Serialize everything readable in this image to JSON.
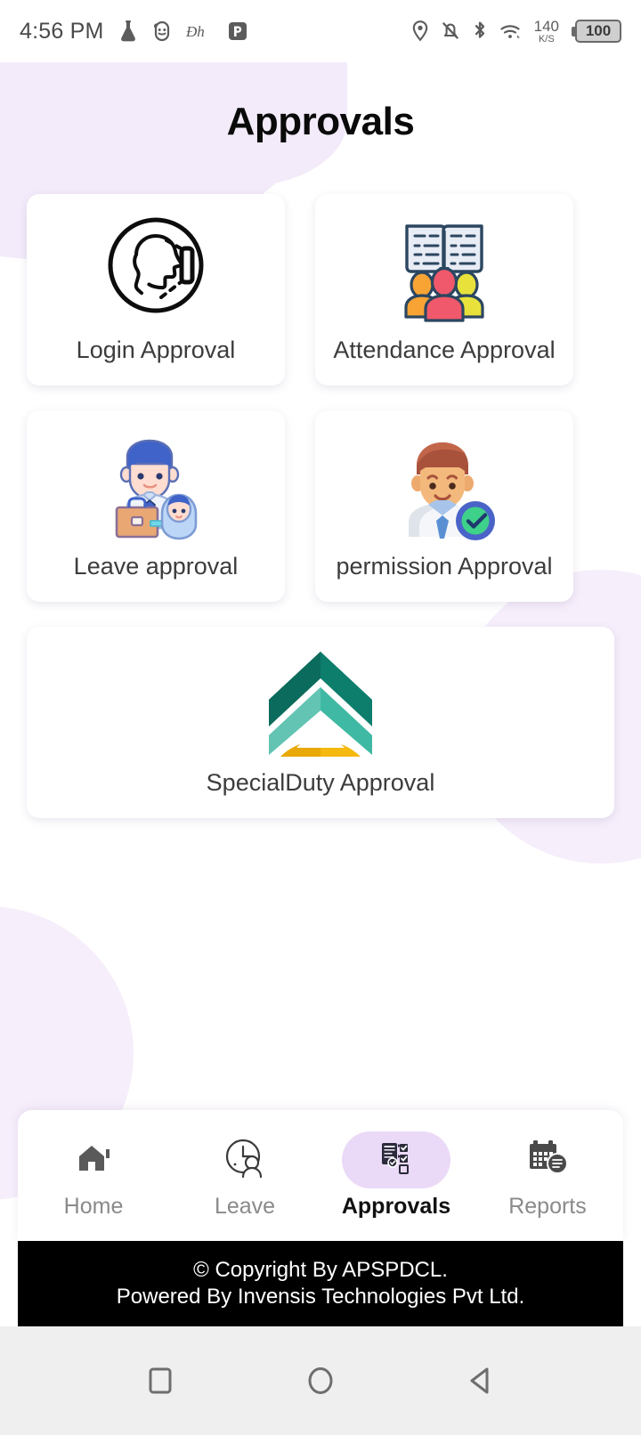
{
  "status_bar": {
    "time": "4:56 PM",
    "left_icons": [
      "flask-icon",
      "face-emoji-icon",
      "dh-text-icon",
      "powerpoint-icon"
    ],
    "right_icons": [
      "location-pin-icon",
      "notifications-muted-icon",
      "bluetooth-icon",
      "wifi-icon"
    ],
    "network_speed_value": "140",
    "network_speed_unit": "K/S",
    "battery_level": "100"
  },
  "header": {
    "title": "Approvals"
  },
  "cards": [
    {
      "label": "Login Approval",
      "icon": "face-recognition-icon"
    },
    {
      "label": "Attendance Approval",
      "icon": "attendance-register-people-icon"
    },
    {
      "label": "Leave approval",
      "icon": "paternity-leave-icon"
    },
    {
      "label": "permission Approval",
      "icon": "approved-employee-icon"
    },
    {
      "label": "SpecialDuty Approval",
      "icon": "rank-chevron-icon"
    }
  ],
  "bottom_nav": {
    "items": [
      {
        "label": "Home",
        "icon": "home-icon",
        "active": false
      },
      {
        "label": "Leave",
        "icon": "clock-person-icon",
        "active": false
      },
      {
        "label": "Approvals",
        "icon": "clipboard-check-icon",
        "active": true
      },
      {
        "label": "Reports",
        "icon": "calendar-report-icon",
        "active": false
      }
    ]
  },
  "footer": {
    "line1": "© Copyright By APSPDCL.",
    "line2": "Powered By Invensis Technologies Pvt Ltd."
  },
  "android_nav": {
    "recents": "square-recents-icon",
    "home": "circle-home-icon",
    "back": "triangle-back-icon"
  },
  "colors": {
    "accent_lavender": "#ead9f7",
    "blob_lavender": "#f3ebfa",
    "footer_bg": "#000000",
    "text_dark": "#3c3c3c",
    "text_muted": "#8a8a8a"
  }
}
